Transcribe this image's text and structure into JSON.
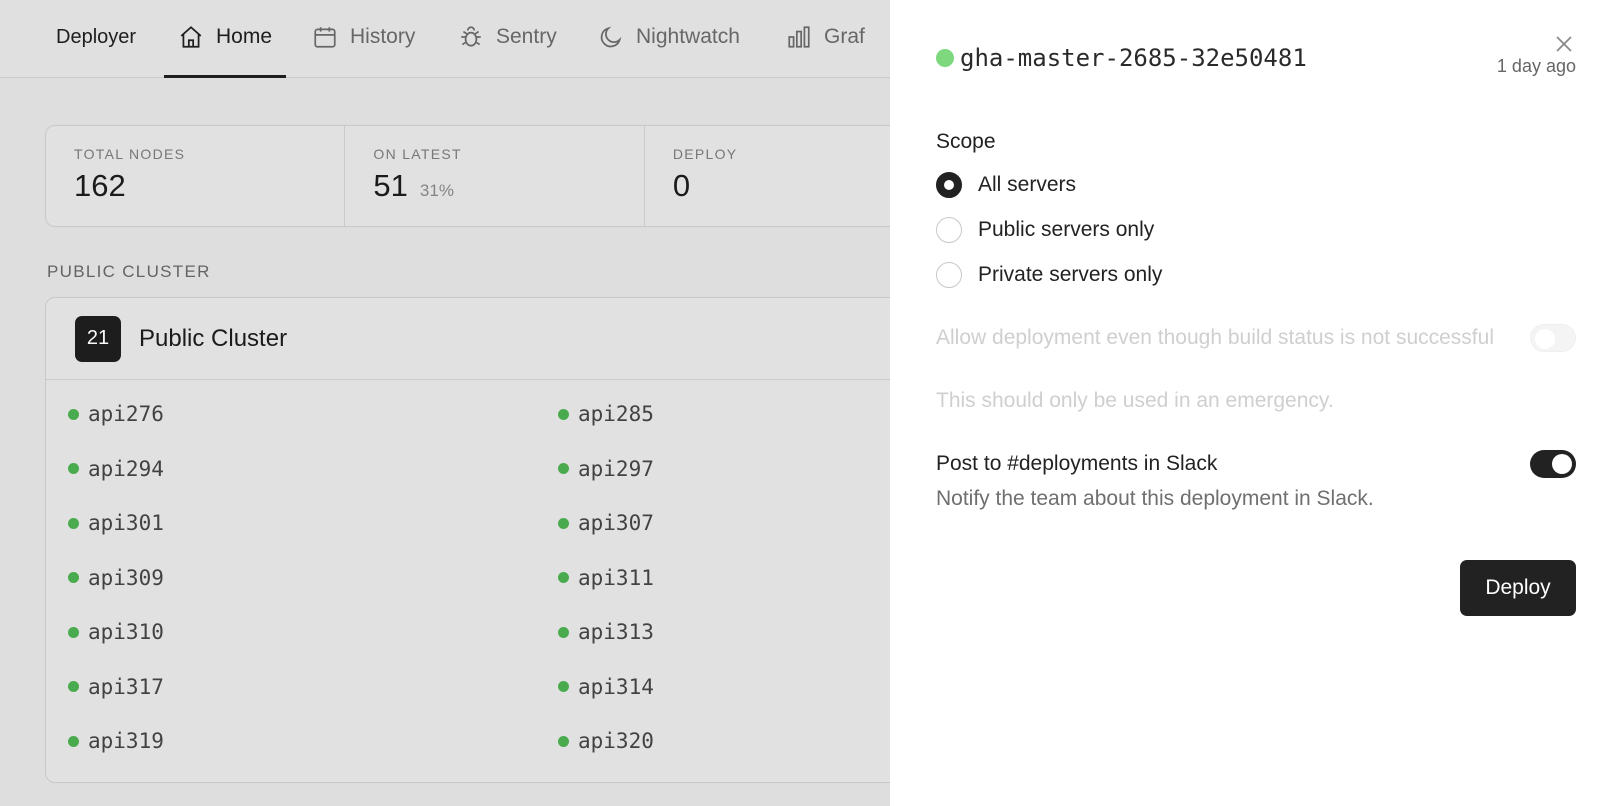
{
  "nav": {
    "brand": "Deployer",
    "items": [
      {
        "label": "Home",
        "icon": "home-icon",
        "active": true
      },
      {
        "label": "History",
        "icon": "calendar-icon"
      },
      {
        "label": "Sentry",
        "icon": "bug-icon"
      },
      {
        "label": "Nightwatch",
        "icon": "moon-icon"
      },
      {
        "label": "Graf",
        "icon": "bar-chart-icon"
      }
    ]
  },
  "stats": [
    {
      "label": "TOTAL NODES",
      "value": "162",
      "pct": ""
    },
    {
      "label": "ON LATEST",
      "value": "51",
      "pct": "31%"
    },
    {
      "label": "DEPLOY",
      "value": "0",
      "pct": ""
    }
  ],
  "section_title": "PUBLIC CLUSTER",
  "cluster": {
    "count": "21",
    "name": "Public Cluster",
    "nodes_left": [
      "api276",
      "api294",
      "api301",
      "api309",
      "api310",
      "api317",
      "api319"
    ],
    "nodes_right": [
      "api285",
      "api297",
      "api307",
      "api311",
      "api313",
      "api314",
      "api320"
    ],
    "status_color": "#4caf50"
  },
  "drawer": {
    "build_id": "gha-master-2685-32e50481",
    "time_ago": "1 day ago",
    "scope_label": "Scope",
    "scope_options": [
      {
        "label": "All servers",
        "checked": true
      },
      {
        "label": "Public servers only",
        "checked": false
      },
      {
        "label": "Private servers only",
        "checked": false
      }
    ],
    "allow_title": "Allow deployment even though build status is not successful",
    "allow_desc": "This should only be used in an emergency.",
    "allow_enabled": false,
    "slack_title": "Post to #deployments in Slack",
    "slack_desc": "Notify the team about this deployment in Slack.",
    "slack_enabled": true,
    "deploy_label": "Deploy"
  }
}
